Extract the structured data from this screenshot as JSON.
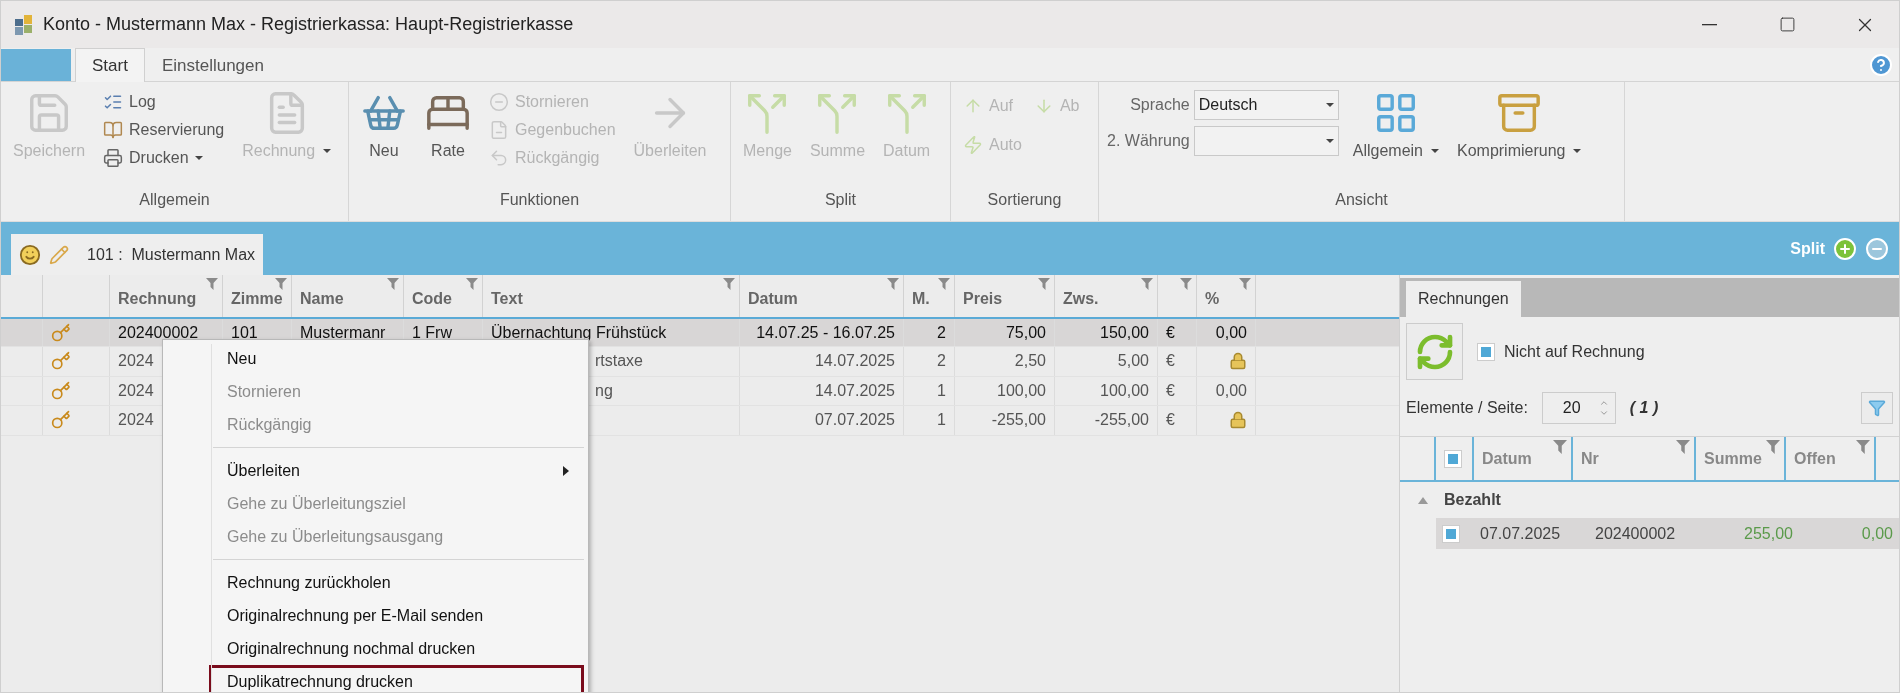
{
  "window": {
    "title": "Konto - Mustermann Max - Registrierkassa: Haupt-Registrierkasse"
  },
  "ribbon_tabs": [
    {
      "label": "Start",
      "selected": true
    },
    {
      "label": "Einstellungen",
      "selected": false
    }
  ],
  "ribbon_groups": [
    {
      "label": "Allgemein",
      "items": [
        {
          "kind": "large",
          "label": "Speichern",
          "disabled": true,
          "dropdown": false
        },
        {
          "kind": "stack",
          "items": [
            {
              "label": "Log",
              "disabled": false,
              "dropdown": false
            },
            {
              "label": "Reservierung",
              "disabled": false,
              "dropdown": false
            },
            {
              "label": "Drucken",
              "disabled": false,
              "dropdown": true
            }
          ]
        },
        {
          "kind": "large",
          "label": "Rechnung",
          "disabled": true,
          "dropdown": true
        }
      ]
    },
    {
      "label": "Funktionen",
      "items": [
        {
          "kind": "large",
          "label": "Neu",
          "disabled": false,
          "dropdown": false
        },
        {
          "kind": "large",
          "label": "Rate",
          "disabled": false,
          "dropdown": false
        },
        {
          "kind": "stack",
          "items": [
            {
              "label": "Stornieren",
              "disabled": true,
              "dropdown": false
            },
            {
              "label": "Gegenbuchen",
              "disabled": true,
              "dropdown": false
            },
            {
              "label": "Rückgängig",
              "disabled": true,
              "dropdown": false
            }
          ]
        },
        {
          "kind": "large",
          "label": "Überleiten",
          "disabled": true,
          "dropdown": false
        }
      ]
    },
    {
      "label": "Split",
      "items": [
        {
          "kind": "large",
          "label": "Menge",
          "disabled": true,
          "dropdown": false
        },
        {
          "kind": "large",
          "label": "Summe",
          "disabled": true,
          "dropdown": false
        },
        {
          "kind": "large",
          "label": "Datum",
          "disabled": true,
          "dropdown": false
        }
      ]
    },
    {
      "label": "Sortierung",
      "items": [
        {
          "kind": "grid",
          "items": [
            {
              "label": "Auf",
              "disabled": true,
              "dropdown": false
            },
            {
              "label": "Ab",
              "disabled": true,
              "dropdown": false
            },
            {
              "label": "Auto",
              "disabled": true,
              "dropdown": false
            }
          ]
        }
      ]
    },
    {
      "label": "Ansicht",
      "items": [
        {
          "kind": "fields",
          "fields": [
            {
              "label": "Sprache",
              "value": "Deutsch"
            },
            {
              "label": "2. Währung"
            }
          ]
        },
        {
          "kind": "large",
          "label": "Allgemein",
          "disabled": false,
          "dropdown": true
        },
        {
          "kind": "large",
          "label": "Komprimierung",
          "disabled": false,
          "dropdown": true
        }
      ]
    }
  ],
  "document_tab": {
    "label": "101 :  Mustermann Max"
  },
  "split_bar": {
    "label": "Split",
    "remove_disabled": true
  },
  "table": {
    "columns": [
      "Rechnung",
      "Zimme",
      "Name",
      "Code",
      "Text",
      "Datum",
      "M.",
      "Preis",
      "Zws.",
      "%"
    ],
    "rows": [
      {
        "selected": true,
        "rechnung": "202400002",
        "zimmer": "101",
        "name": "Mustermanr",
        "code": "1 Frw",
        "text": "Übernachtung Frühstück",
        "datum": "14.07.25 - 16.07.25",
        "menge": "2",
        "preis": "75,00",
        "zws": "150,00",
        "currency": "€",
        "locked": false,
        "percent": "0,00"
      },
      {
        "selected": false,
        "rechnung": "2024",
        "text": "rtstaxe",
        "datum": "14.07.2025",
        "menge": "2",
        "preis": "2,50",
        "zws": "5,00",
        "currency": "€",
        "locked": true
      },
      {
        "selected": false,
        "rechnung": "2024",
        "text": "ng",
        "datum": "14.07.2025",
        "menge": "1",
        "preis": "100,00",
        "zws": "100,00",
        "currency": "€",
        "locked": false,
        "percent": "0,00"
      },
      {
        "selected": false,
        "rechnung": "2024",
        "datum": "07.07.2025",
        "menge": "1",
        "preis": "-255,00",
        "zws": "-255,00",
        "currency": "€",
        "locked": true
      }
    ]
  },
  "context_menu": [
    {
      "kind": "item",
      "label": "Neu",
      "disabled": false,
      "submenu": false,
      "highlighted": false
    },
    {
      "kind": "item",
      "label": "Stornieren",
      "disabled": true,
      "submenu": false,
      "highlighted": false
    },
    {
      "kind": "item",
      "label": "Rückgängig",
      "disabled": true,
      "submenu": false,
      "highlighted": false
    },
    {
      "kind": "separator"
    },
    {
      "kind": "item",
      "label": "Überleiten",
      "disabled": false,
      "submenu": true,
      "highlighted": false
    },
    {
      "kind": "item",
      "label": "Gehe zu Überleitungsziel",
      "disabled": true,
      "submenu": false,
      "highlighted": false
    },
    {
      "kind": "item",
      "label": "Gehe zu Überleitungsausgang",
      "disabled": true,
      "submenu": false,
      "highlighted": false
    },
    {
      "kind": "separator"
    },
    {
      "kind": "item",
      "label": "Rechnung zurückholen",
      "disabled": false,
      "submenu": false,
      "highlighted": false
    },
    {
      "kind": "item",
      "label": "Originalrechnung per E-Mail senden",
      "disabled": false,
      "submenu": false,
      "highlighted": false
    },
    {
      "kind": "item",
      "label": "Originalrechnung nochmal drucken",
      "disabled": false,
      "submenu": false,
      "highlighted": false
    },
    {
      "kind": "item",
      "label": "Duplikatrechnung drucken",
      "disabled": false,
      "submenu": false,
      "highlighted": true
    }
  ],
  "invoices_panel": {
    "tab": "Rechnungen",
    "filter_checkbox": {
      "label": "Nicht auf Rechnung",
      "checked": true
    },
    "page_size_label": "Elemente / Seite:",
    "page_size": "20",
    "page_count": "( 1 )",
    "columns": [
      "Datum",
      "Nr",
      "Summe",
      "Offen"
    ],
    "header_checked": true,
    "groups": [
      {
        "label": "Bezahlt",
        "expanded": true,
        "rows": [
          {
            "selected": true,
            "checked": true,
            "datum": "07.07.2025",
            "nr": "202400002",
            "summe": "255,00",
            "offen": "0,00"
          }
        ]
      }
    ]
  }
}
